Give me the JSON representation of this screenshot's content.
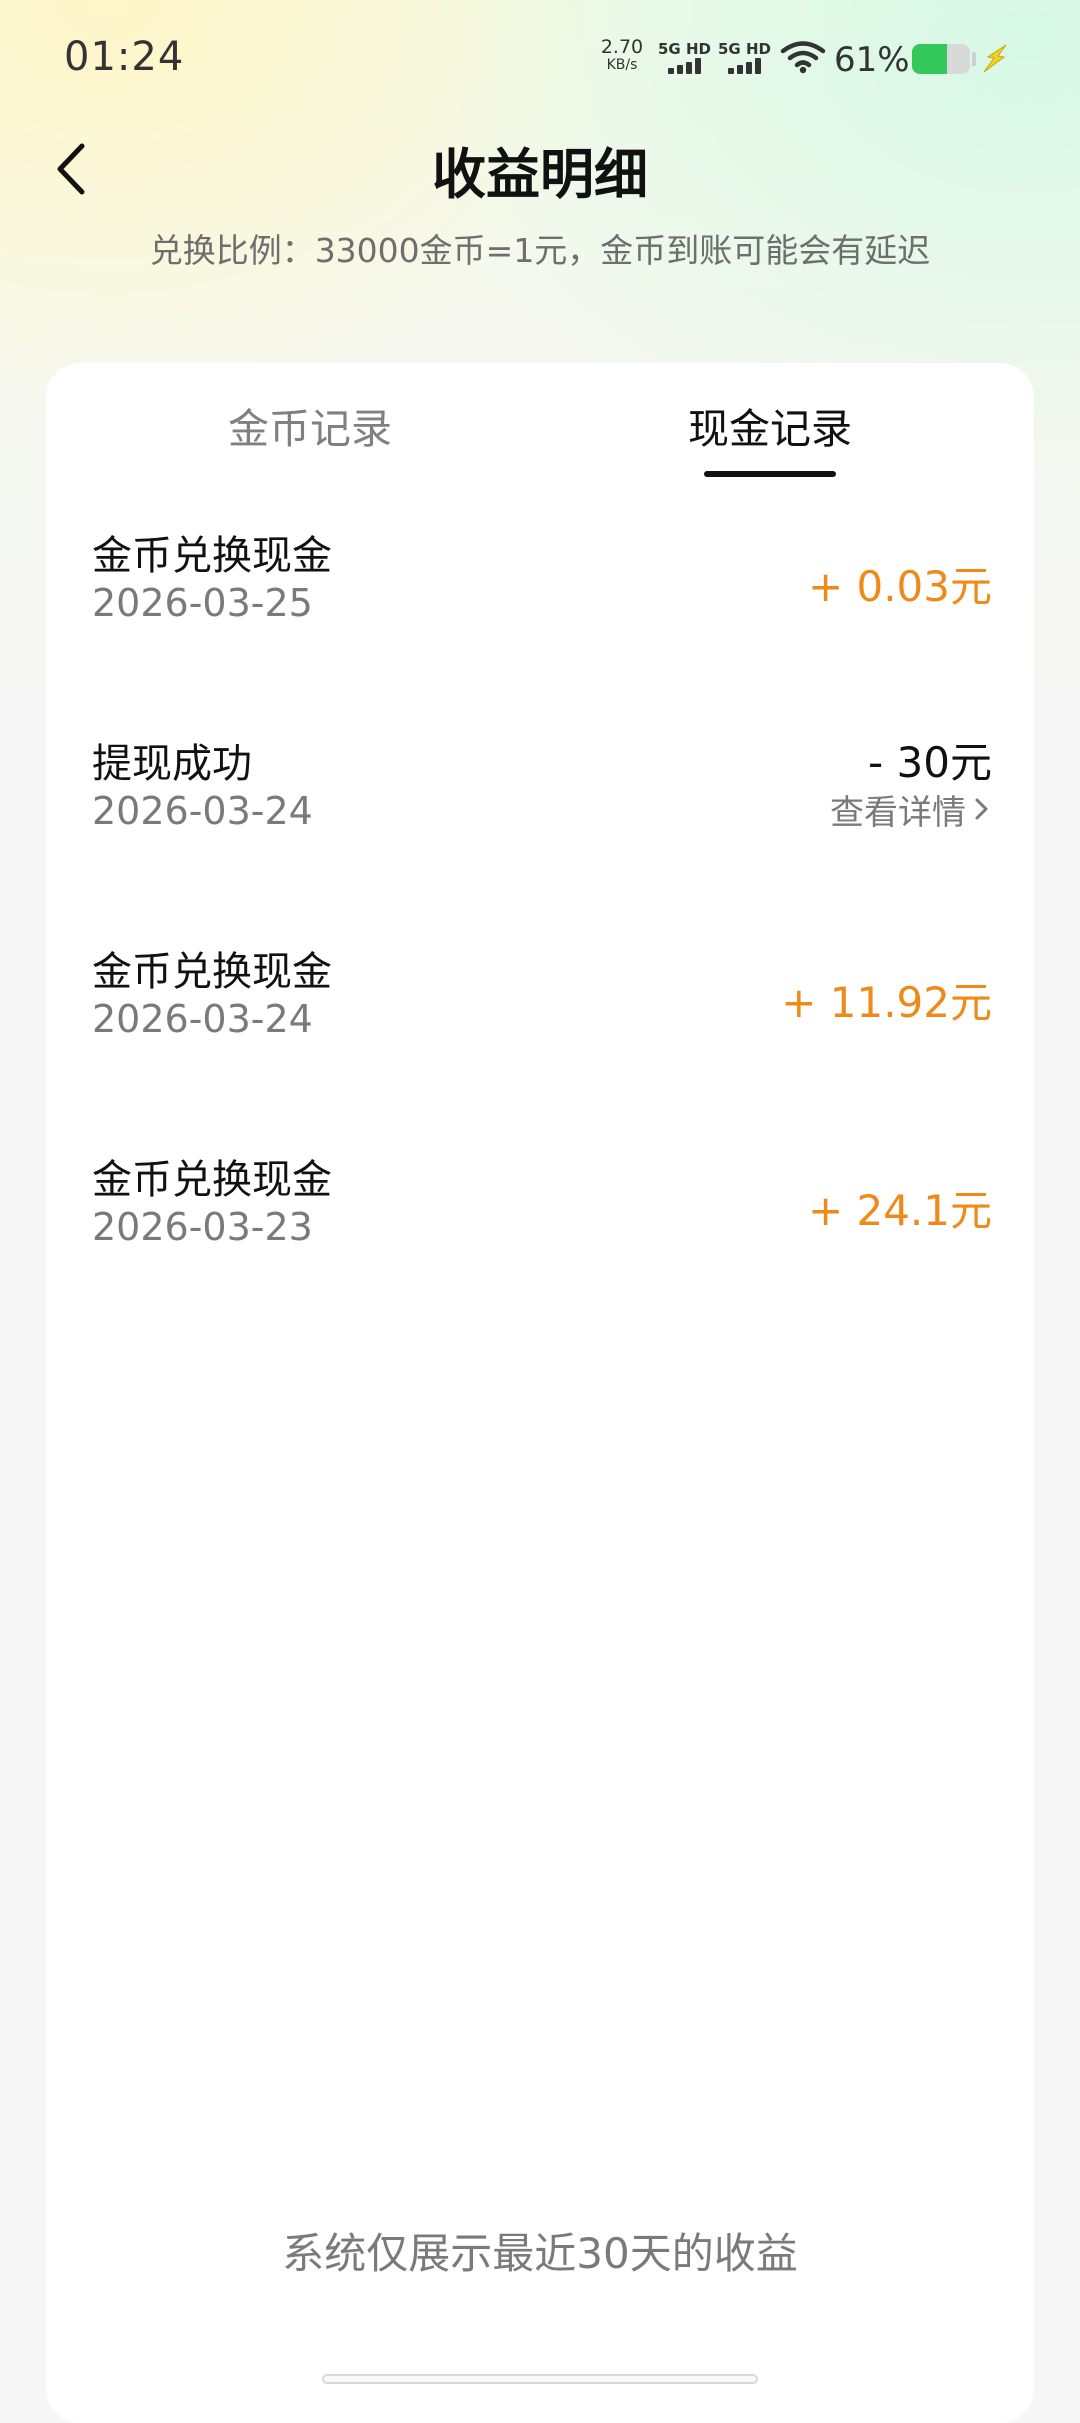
{
  "status_bar": {
    "time": "01:24",
    "net_speed_value": "2.70",
    "net_speed_unit": "KB/s",
    "sim1_label": "5G HD",
    "sim2_label": "5G HD",
    "battery_percent": "61%",
    "battery_level": 0.61,
    "battery_color": "#34c759"
  },
  "header": {
    "back_icon": "chevron-left-icon",
    "title": "收益明细",
    "subtitle": "兑换比例：33000金币=1元，金币到账可能会有延迟"
  },
  "tabs": [
    {
      "label": "金币记录",
      "active": false
    },
    {
      "label": "现金记录",
      "active": true
    }
  ],
  "records": [
    {
      "title": "金币兑换现金",
      "date": "2026-03-25",
      "amount": "+ 0.03元",
      "type": "income"
    },
    {
      "title": "提现成功",
      "date": "2026-03-24",
      "amount": "- 30元",
      "type": "withdraw",
      "detail_label": "查看详情"
    },
    {
      "title": "金币兑换现金",
      "date": "2026-03-24",
      "amount": "+ 11.92元",
      "type": "income"
    },
    {
      "title": "金币兑换现金",
      "date": "2026-03-23",
      "amount": "+ 24.1元",
      "type": "income"
    }
  ],
  "footnote": "系统仅展示最近30天的收益",
  "colors": {
    "income": "#ef8a1a",
    "text_primary": "#111111",
    "text_secondary": "#7a7a7a"
  }
}
